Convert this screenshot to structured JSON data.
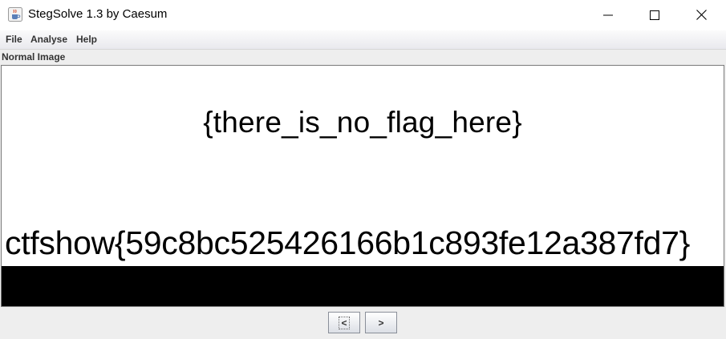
{
  "window": {
    "title": "StegSolve 1.3 by Caesum"
  },
  "menu": {
    "items": [
      "File",
      "Analyse",
      "Help"
    ]
  },
  "view": {
    "mode_label": "Normal Image",
    "image_text_line1": "{there_is_no_flag_here}",
    "image_text_line2": "ctfshow{59c8bc525426166b1c893fe12a387fd7}"
  },
  "nav": {
    "prev_label": "<",
    "next_label": ">"
  },
  "icons": {
    "app": "java-coffee-cup-icon",
    "minimize": "minimize-icon",
    "maximize": "maximize-icon",
    "close": "close-icon"
  }
}
